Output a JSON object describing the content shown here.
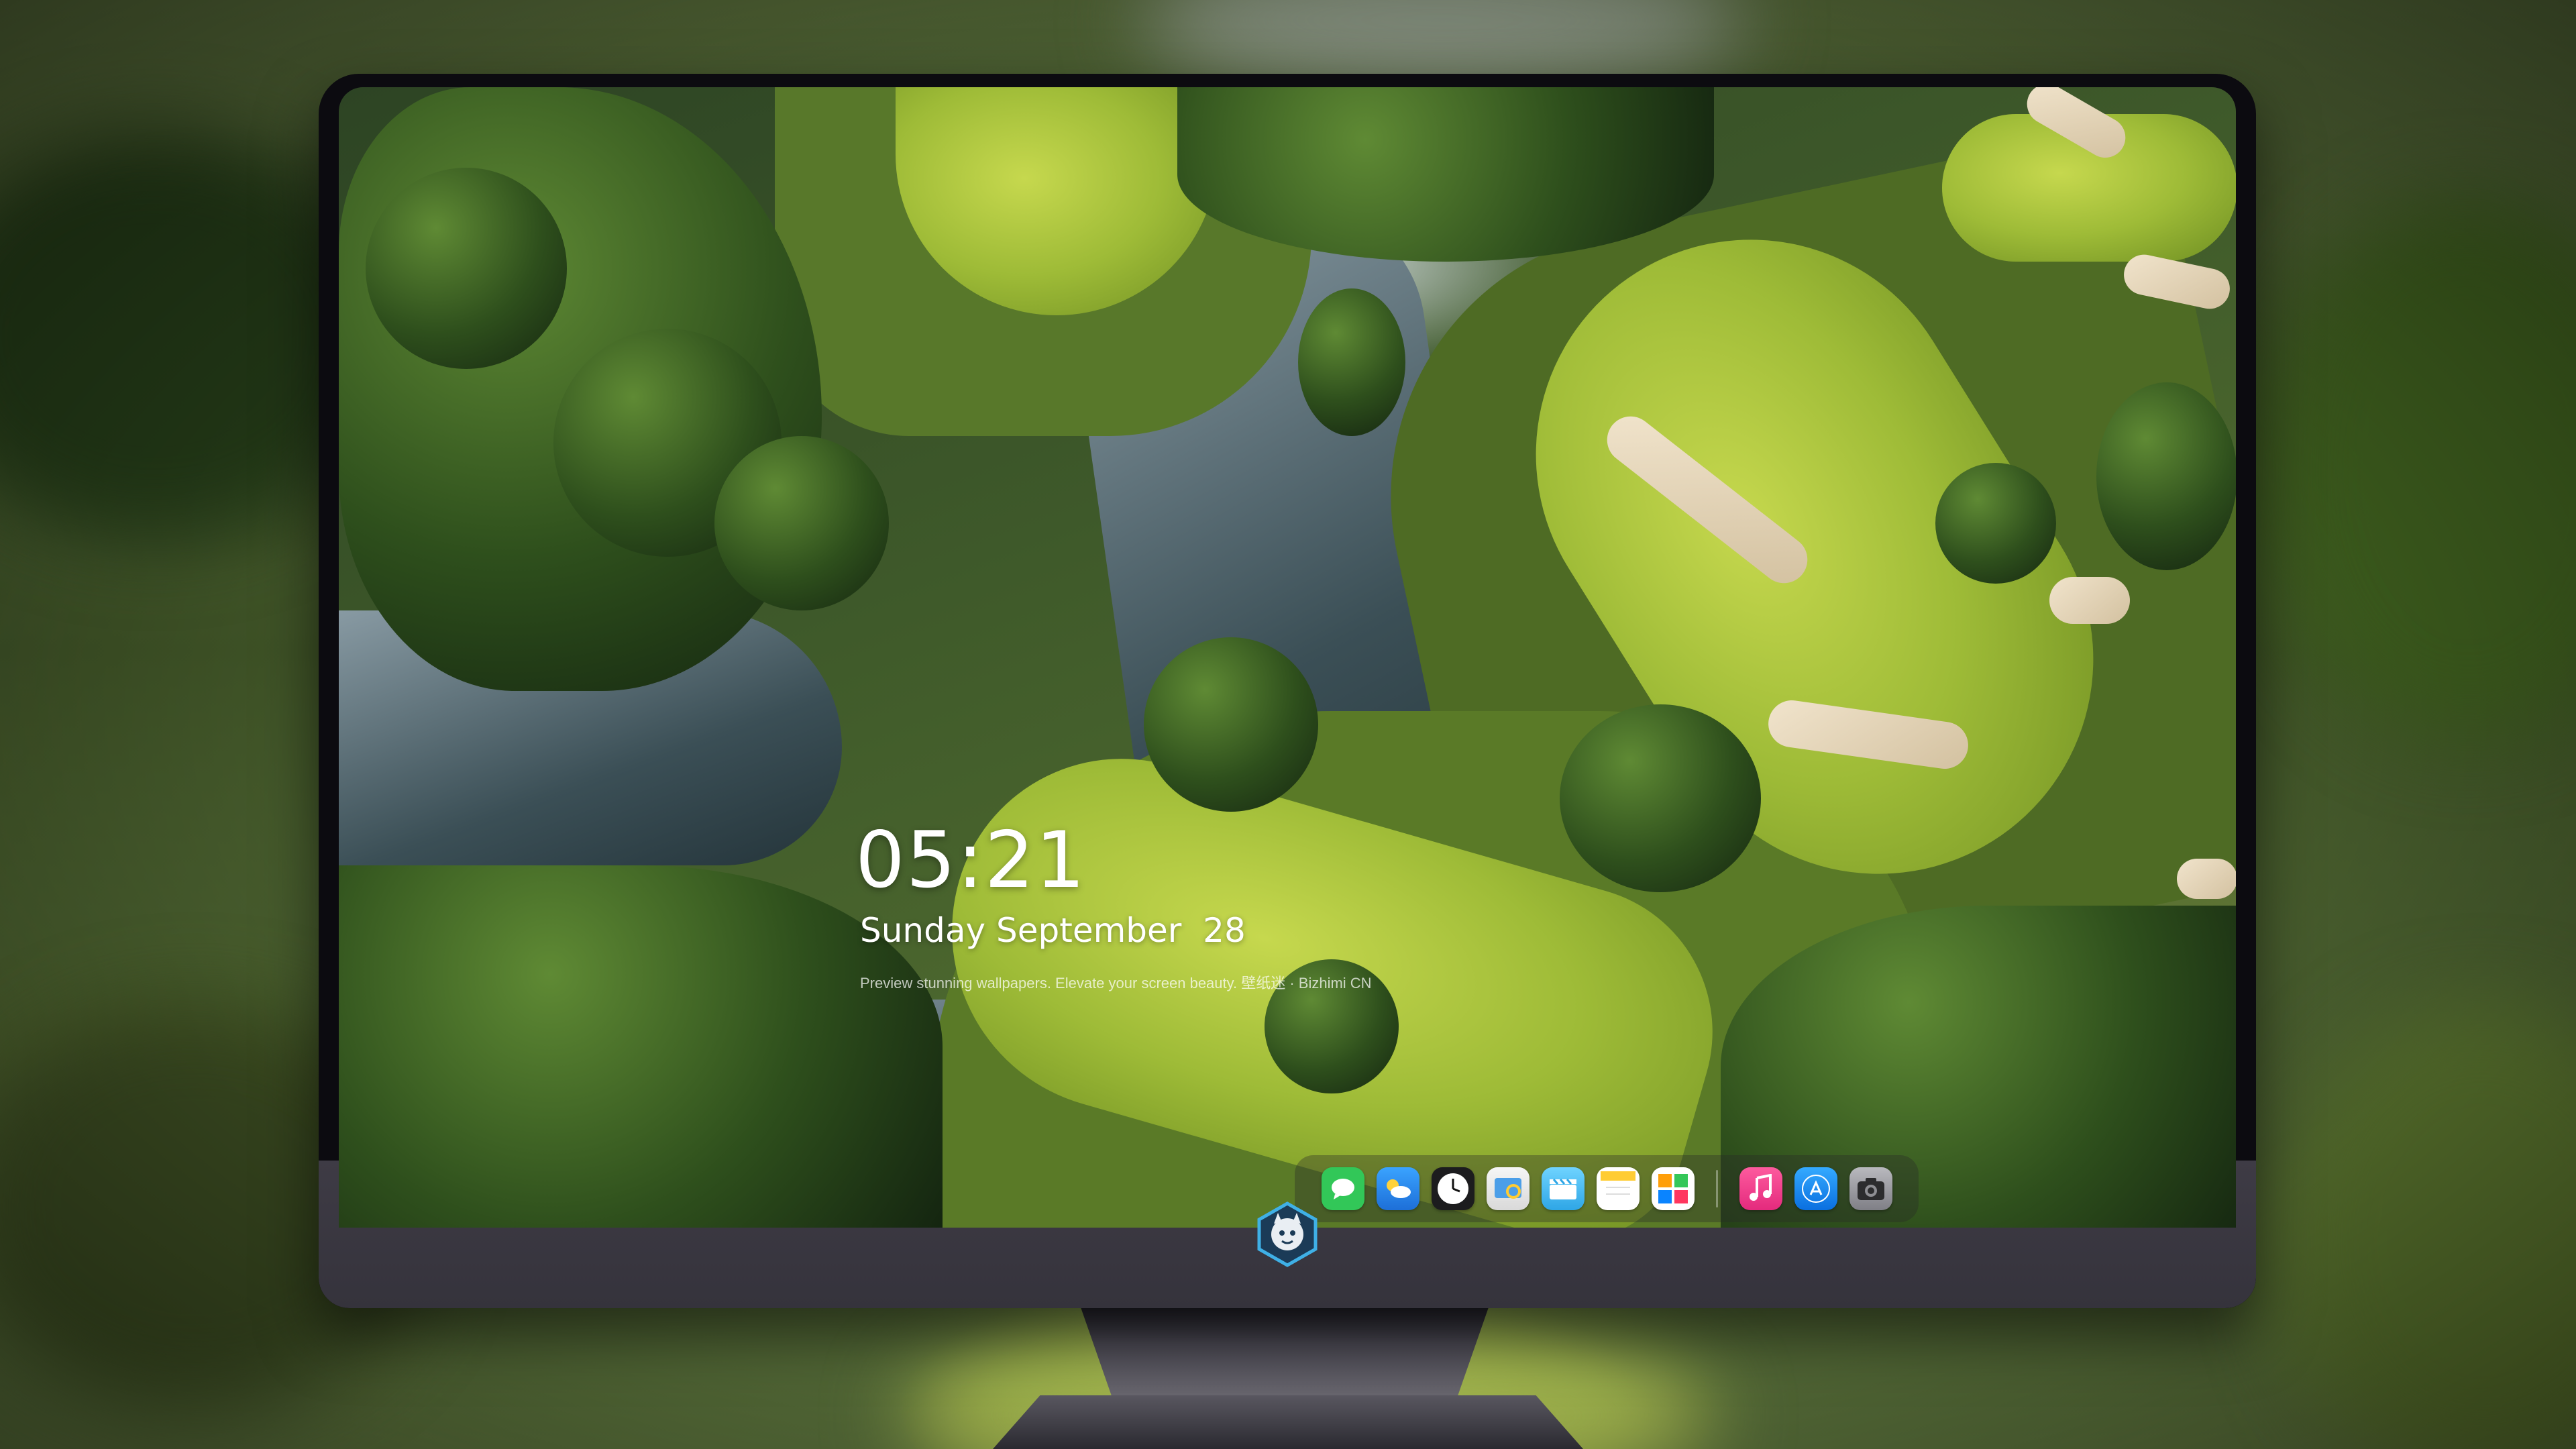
{
  "lock_screen": {
    "time": "05:21",
    "date": "Sunday September  28",
    "caption": "Preview stunning wallpapers. Elevate your screen beauty. 壁纸迷 · Bizhimi CN"
  },
  "dock": {
    "apps": [
      {
        "name": "messages",
        "icon": "message-bubble-icon",
        "color": "#32c758"
      },
      {
        "name": "weather",
        "icon": "weather-cloud-icon",
        "color": "#2f8cf0"
      },
      {
        "name": "clock",
        "icon": "clock-icon",
        "color": "#f2f2f2"
      },
      {
        "name": "preview",
        "icon": "preview-icon",
        "color": "#4b9ee8"
      },
      {
        "name": "clips",
        "icon": "clapperboard-icon",
        "color": "#5ac8fa"
      },
      {
        "name": "notes",
        "icon": "notes-icon",
        "color": "#ffcc33"
      },
      {
        "name": "photo-booth",
        "icon": "photo-booth-icon",
        "color": "#2f7ae5"
      },
      {
        "name": "music",
        "icon": "music-note-icon",
        "color": "#fc3c8f"
      },
      {
        "name": "app-store",
        "icon": "app-store-icon",
        "color": "#1c8df5"
      },
      {
        "name": "camera",
        "icon": "camera-icon",
        "color": "#8e8e93"
      }
    ]
  },
  "colors": {
    "monitor_chin": "#3e3b45",
    "monitor_bezel": "#0c0b10",
    "logo_accent": "#3fb0e6"
  }
}
